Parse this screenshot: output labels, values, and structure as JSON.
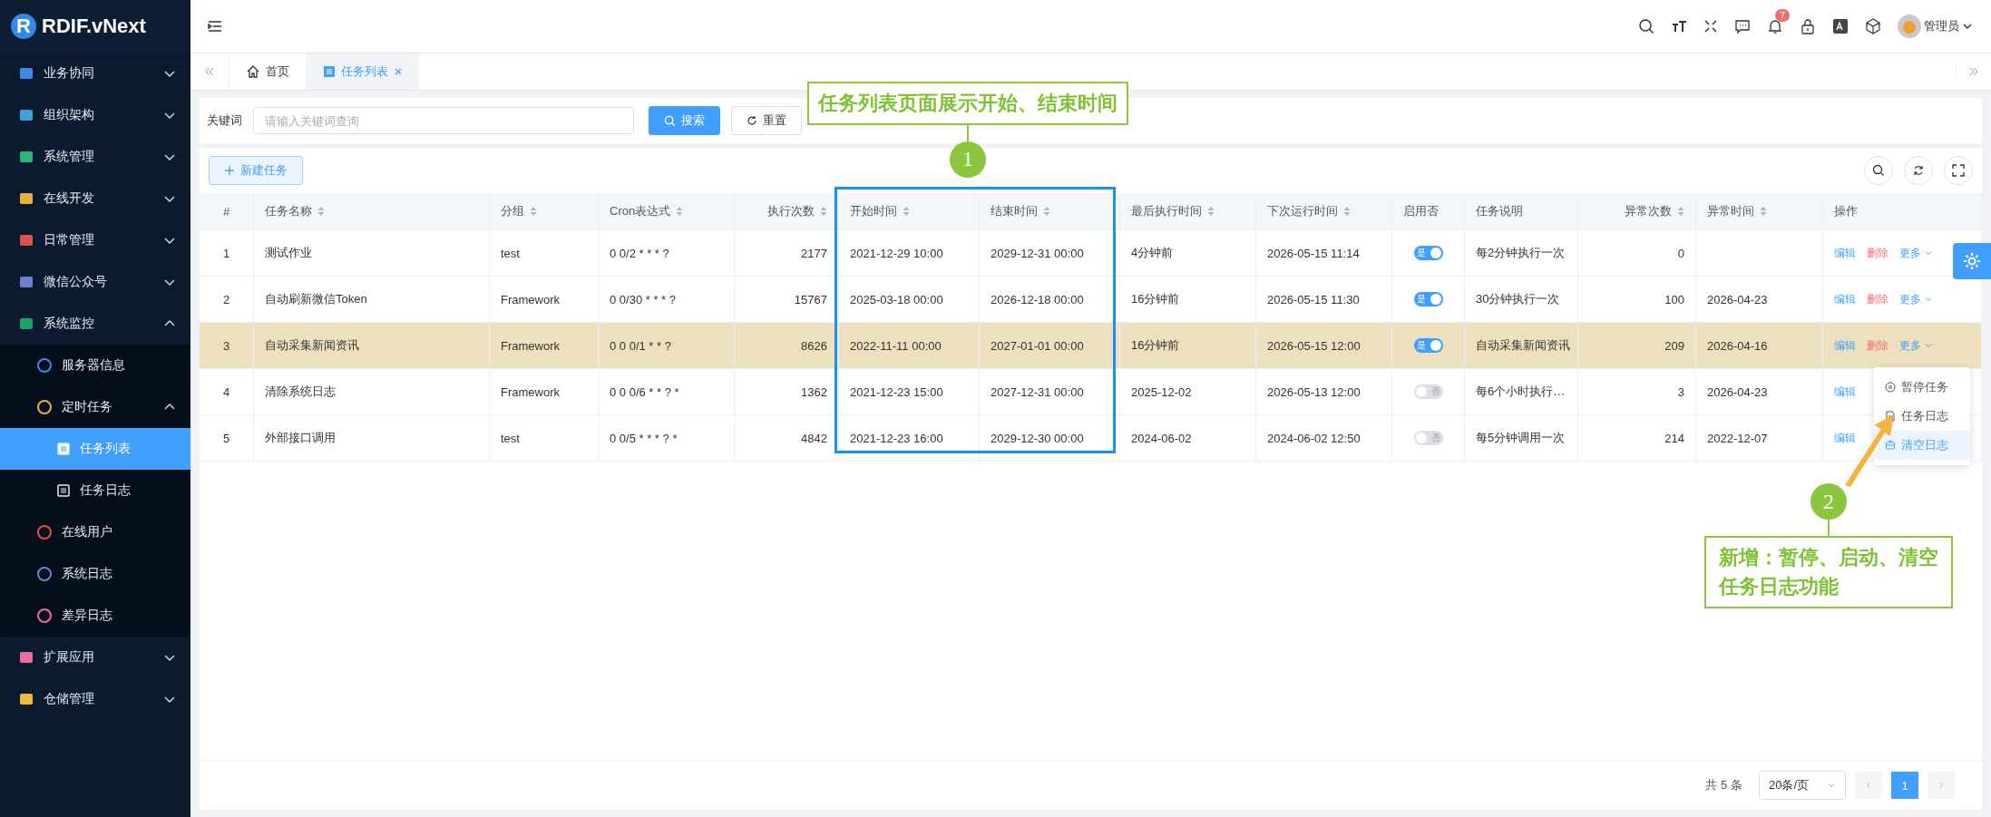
{
  "logo": {
    "badge": "R",
    "text": "RDIF.vNext"
  },
  "sidebar": {
    "items": [
      {
        "label": "业务协同",
        "expanded": false,
        "selected": false
      },
      {
        "label": "组织架构",
        "expanded": false,
        "selected": false
      },
      {
        "label": "系统管理",
        "expanded": false,
        "selected": false
      },
      {
        "label": "在线开发",
        "expanded": false,
        "selected": false
      },
      {
        "label": "日常管理",
        "expanded": false,
        "selected": false
      },
      {
        "label": "微信公众号",
        "expanded": false,
        "selected": false
      },
      {
        "label": "系统监控",
        "expanded": true,
        "selected": false,
        "children": [
          {
            "label": "服务器信息",
            "selected": false
          },
          {
            "label": "定时任务",
            "expanded": true,
            "selected": false,
            "children": [
              {
                "label": "任务列表",
                "selected": true
              },
              {
                "label": "任务日志",
                "selected": false
              }
            ]
          },
          {
            "label": "在线用户",
            "selected": false
          },
          {
            "label": "系统日志",
            "selected": false
          },
          {
            "label": "差异日志",
            "selected": false
          }
        ]
      },
      {
        "label": "扩展应用",
        "expanded": false,
        "selected": false
      },
      {
        "label": "仓储管理",
        "expanded": false,
        "selected": false
      }
    ]
  },
  "header": {
    "notification_count": "7",
    "user_name": "管理员"
  },
  "tabs": [
    {
      "label": "首页",
      "selected": false,
      "closable": false
    },
    {
      "label": "任务列表",
      "selected": true,
      "closable": true
    }
  ],
  "search": {
    "label": "关键词",
    "placeholder": "请输入关键词查询",
    "search_button": "搜索",
    "reset_button": "重置"
  },
  "new_button": "新建任务",
  "table": {
    "columns": [
      {
        "label": "#",
        "sortable": false
      },
      {
        "label": "任务名称",
        "sortable": true
      },
      {
        "label": "分组",
        "sortable": true
      },
      {
        "label": "Cron表达式",
        "sortable": true
      },
      {
        "label": "执行次数",
        "sortable": true
      },
      {
        "label": "开始时间",
        "sortable": true
      },
      {
        "label": "结束时间",
        "sortable": true
      },
      {
        "label": "最后执行时间",
        "sortable": true
      },
      {
        "label": "下次运行时间",
        "sortable": true
      },
      {
        "label": "启用否",
        "sortable": false
      },
      {
        "label": "任务说明",
        "sortable": false
      },
      {
        "label": "异常次数",
        "sortable": true
      },
      {
        "label": "异常时间",
        "sortable": true
      },
      {
        "label": "操作",
        "sortable": false
      }
    ],
    "rows": [
      {
        "selected": false,
        "no": "1",
        "name": "测试作业",
        "group": "test",
        "cron": "0 0/2 * * * ?",
        "runs": "2177",
        "start": "2021-12-29 10:00",
        "end": "2029-12-31 00:00",
        "last_run": "4分钟前",
        "next_run": "2026-05-15 11:14",
        "enabled": true,
        "enabled_label": "是",
        "description": "每2分钟执行一次",
        "error_count": "0",
        "actions": [
          {
            "label": "编辑",
            "kind": "edit"
          },
          {
            "label": "删除",
            "kind": "delete"
          },
          {
            "label": "更多",
            "kind": "more"
          }
        ]
      },
      {
        "selected": false,
        "no": "2",
        "name": "自动刷新微信Token",
        "group": "Framework",
        "cron": "0 0/30 * * * ?",
        "runs": "15767",
        "start": "2025-03-18 00:00",
        "end": "2026-12-18 00:00",
        "last_run": "16分钟前",
        "next_run": "2026-05-15 11:30",
        "enabled": true,
        "enabled_label": "是",
        "description": "30分钟执行一次",
        "error_count": "100",
        "error_time": "2026-04-23",
        "actions": [
          {
            "label": "编辑",
            "kind": "edit"
          },
          {
            "label": "删除",
            "kind": "delete"
          },
          {
            "label": "更多",
            "kind": "more"
          }
        ]
      },
      {
        "selected": true,
        "no": "3",
        "name": "自动采集新闻资讯",
        "group": "Framework",
        "cron": "0 0 0/1 * * ?",
        "runs": "8626",
        "start": "2022-11-11 00:00",
        "end": "2027-01-01 00:00",
        "last_run": "16分钟前",
        "next_run": "2026-05-15 12:00",
        "enabled": true,
        "enabled_label": "是",
        "description": "自动采集新闻资讯",
        "error_count": "209",
        "error_time": "2026-04-16",
        "actions": [
          {
            "label": "编辑",
            "kind": "edit"
          },
          {
            "label": "删除",
            "kind": "delete"
          },
          {
            "label": "更多",
            "kind": "more"
          }
        ]
      },
      {
        "selected": false,
        "no": "4",
        "name": "清除系统日志",
        "group": "Framework",
        "cron": "0 0 0/6 * * ? *",
        "runs": "1362",
        "start": "2021-12-23 15:00",
        "end": "2027-12-31 00:00",
        "last_run": "2025-12-02",
        "next_run": "2026-05-13 12:00",
        "enabled": false,
        "enabled_label": "否",
        "description": "每6个小时执行…",
        "error_count": "3",
        "error_time": "2026-04-23",
        "actions": [
          {
            "label": "编辑",
            "kind": "edit"
          }
        ]
      },
      {
        "selected": false,
        "no": "5",
        "name": "外部接口调用",
        "group": "test",
        "cron": "0 0/5 * * * ? *",
        "runs": "4842",
        "start": "2021-12-23 16:00",
        "end": "2029-12-30 00:00",
        "last_run": "2024-06-02",
        "next_run": "2024-06-02 12:50",
        "enabled": false,
        "enabled_label": "否",
        "description": "每5分钟调用一次",
        "error_count": "214",
        "error_time": "2022-12-07",
        "actions": [
          {
            "label": "编辑",
            "kind": "edit"
          }
        ]
      }
    ]
  },
  "more_menu": {
    "items": [
      {
        "label": "暂停任务",
        "kind": "pause",
        "highlighted": false
      },
      {
        "label": "任务日志",
        "kind": "log",
        "highlighted": false
      },
      {
        "label": "清空日志",
        "kind": "clear",
        "highlighted": true
      }
    ]
  },
  "pagination": {
    "total": "共 5 条",
    "page_size": "20条/页",
    "pages": [
      {
        "label": "1",
        "selected": true
      }
    ]
  },
  "annotations": [
    {
      "number": "1",
      "text": "任务列表页面展示开始、结束时间"
    },
    {
      "number": "2",
      "text": "新增：暂停、启动、清空任务日志功能"
    }
  ]
}
